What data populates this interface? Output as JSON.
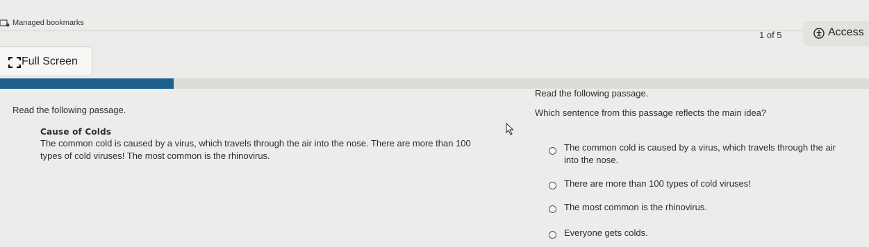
{
  "browser": {
    "bookmarks_label": "Managed bookmarks"
  },
  "toolbar": {
    "page_counter": "1 of 5",
    "accessibility_label": "Access",
    "fullscreen_label": "Full Screen"
  },
  "progress": {
    "fraction": 0.2,
    "color": "#1e5f8e"
  },
  "passage": {
    "instruction": "Read the following passage.",
    "title": "Cause of Colds",
    "lines": [
      "The common cold is caused by a virus, which travels through the air into the nose. There are more than 100",
      "types of cold viruses! The most common is the rhinovirus."
    ]
  },
  "question": {
    "instruction": "Read the following passage.",
    "prompt": "Which sentence from this passage reflects the main idea?",
    "options": [
      {
        "lines": [
          "The common cold is caused by a virus, which travels through the air",
          "into the nose."
        ]
      },
      {
        "lines": [
          "There are more than 100 types of cold viruses!"
        ]
      },
      {
        "lines": [
          "The most common is the rhinovirus."
        ]
      },
      {
        "lines": [
          "Everyone gets colds."
        ]
      }
    ]
  }
}
